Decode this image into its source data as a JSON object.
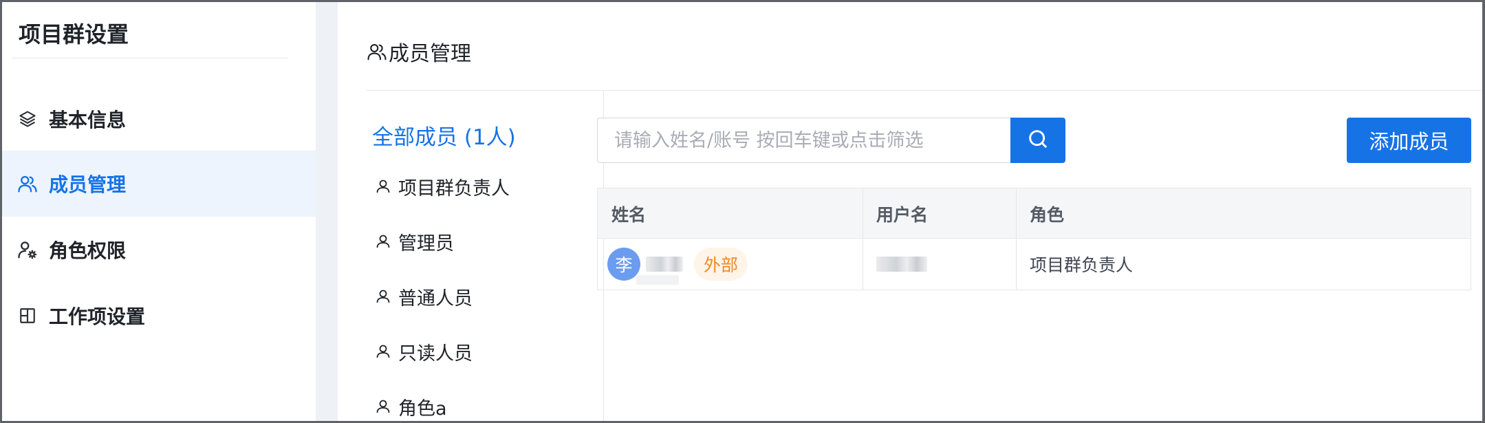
{
  "sidebar": {
    "title": "项目群设置",
    "items": [
      {
        "label": "基本信息",
        "icon": "layers-icon",
        "active": false
      },
      {
        "label": "成员管理",
        "icon": "users-icon",
        "active": true
      },
      {
        "label": "角色权限",
        "icon": "user-settings-icon",
        "active": false
      },
      {
        "label": "工作项设置",
        "icon": "layout-icon",
        "active": false
      }
    ]
  },
  "main": {
    "title": "成员管理",
    "roles": {
      "all_label": "全部成员 (1人)",
      "items": [
        "项目群负责人",
        "管理员",
        "普通人员",
        "只读人员",
        "角色a"
      ]
    },
    "search": {
      "placeholder": "请输入姓名/账号 按回车键或点击筛选",
      "value": ""
    },
    "add_button_label": "添加成员",
    "table": {
      "columns": [
        "姓名",
        "用户名",
        "角色"
      ],
      "rows": [
        {
          "avatar_text": "李",
          "badge": "外部",
          "role": "项目群负责人"
        }
      ]
    }
  },
  "colors": {
    "accent": "#1673e6",
    "active_bg": "#edf4fe",
    "badge_text": "#f08a24",
    "badge_bg": "#fff4e8",
    "avatar_bg": "#6c9cf0"
  }
}
